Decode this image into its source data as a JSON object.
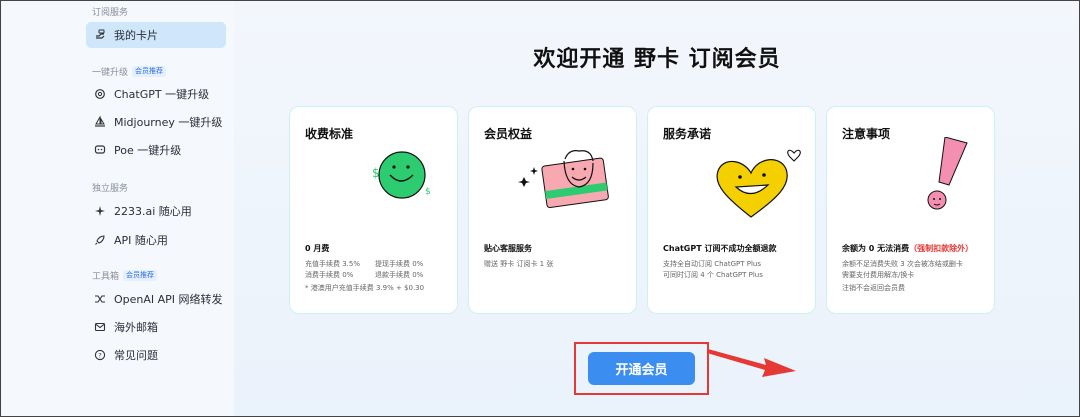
{
  "sidebar": {
    "group_subscription": "订阅服务",
    "my_card": "我的卡片",
    "group_upgrade": "一键升级",
    "upgrade_tag": "会员推荐",
    "chatgpt_upgrade": "ChatGPT 一键升级",
    "midjourney_upgrade": "Midjourney 一键升级",
    "poe_upgrade": "Poe 一键升级",
    "group_independent": "独立服务",
    "ai_free": "2233.ai 随心用",
    "api_free": "API 随心用",
    "group_tools": "工具箱",
    "tools_tag": "会员推荐",
    "openai_forward": "OpenAI API 网络转发",
    "overseas_mail": "海外邮箱",
    "faq": "常见问题"
  },
  "main": {
    "title": "欢迎开通 野卡 订阅会员",
    "cta": "开通会员"
  },
  "cards": [
    {
      "title": "收费标准",
      "subtitle": "0 月费",
      "lines": [
        [
          "充值手续费 3.5%",
          "提现手续费 0%"
        ],
        [
          "消费手续费 0%",
          "退款手续费 0%"
        ]
      ],
      "note": "* 港澳用户充值手续费 3.9% + $0.30"
    },
    {
      "title": "会员权益",
      "subtitle": "贴心客服服务",
      "line1": "赠送 野卡 订阅卡 1 张"
    },
    {
      "title": "服务承诺",
      "subtitle": "ChatGPT 订阅不成功全额退款",
      "line1": "支持全自动订阅 ChatGPT Plus",
      "line2": "可同时订阅 4 个 ChatGPT Plus"
    },
    {
      "title": "注意事项",
      "subtitle_prefix": "余额为 0 无法消费",
      "subtitle_red": "（强制扣款除外）",
      "line1": "余额不足消费失败 3 次会被冻结或删卡",
      "line2": "需要支付费用解冻/换卡",
      "line3": "注销不会返回会员费"
    }
  ],
  "colors": {
    "accent": "#3b8df0",
    "active_bg": "#cfe6fb",
    "highlight_red": "#e53935",
    "smiley_green": "#2ecc71",
    "heart_yellow": "#f5d000",
    "exclaim_pink": "#f48fb1"
  }
}
